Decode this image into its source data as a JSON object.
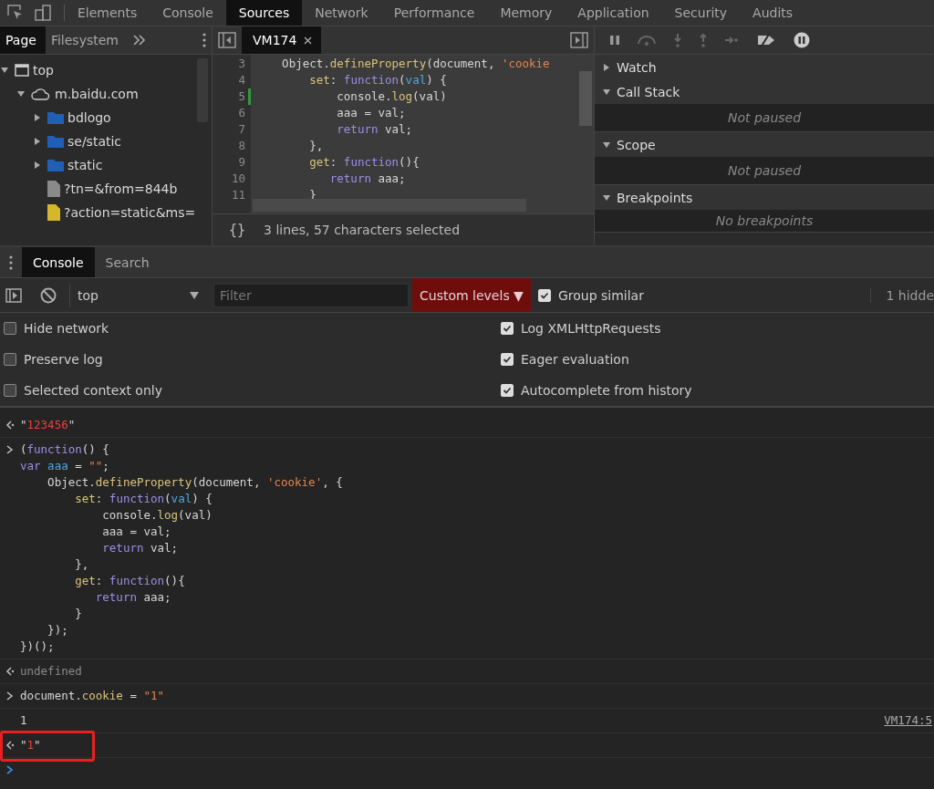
{
  "main_tabs": [
    {
      "label": "Elements",
      "selected": false
    },
    {
      "label": "Console",
      "selected": false
    },
    {
      "label": "Sources",
      "selected": true
    },
    {
      "label": "Network",
      "selected": false
    },
    {
      "label": "Performance",
      "selected": false
    },
    {
      "label": "Memory",
      "selected": false
    },
    {
      "label": "Application",
      "selected": false
    },
    {
      "label": "Security",
      "selected": false
    },
    {
      "label": "Audits",
      "selected": false
    }
  ],
  "navigator": {
    "tabs": [
      {
        "label": "Page",
        "selected": true
      },
      {
        "label": "Filesystem",
        "selected": false
      }
    ],
    "tree": [
      {
        "label": "top",
        "kind": "frame",
        "expanded": true,
        "children": [
          {
            "label": "m.baidu.com",
            "kind": "domain",
            "expanded": true,
            "children": [
              {
                "label": "bdlogo",
                "kind": "folder",
                "expanded": false
              },
              {
                "label": "se/static",
                "kind": "folder",
                "expanded": false
              },
              {
                "label": "static",
                "kind": "folder",
                "expanded": false
              },
              {
                "label": "?tn=&from=844b",
                "kind": "file",
                "color": "#8a8a8a"
              },
              {
                "label": "?action=static&ms=",
                "kind": "file",
                "color": "#d6b62a"
              }
            ]
          }
        ]
      }
    ]
  },
  "editor": {
    "tab": "VM174",
    "lines": [
      {
        "number": "3",
        "marked": false,
        "tokens": [
          {
            "kind": "plain",
            "text": "    Object."
          },
          {
            "kind": "fn",
            "text": "defineProperty"
          },
          {
            "kind": "plain",
            "text": "(document, "
          },
          {
            "kind": "str",
            "text": "'cookie"
          }
        ]
      },
      {
        "number": "4",
        "marked": false,
        "tokens": [
          {
            "kind": "fn",
            "text": "        set"
          },
          {
            "kind": "plain",
            "text": ": "
          },
          {
            "kind": "kw",
            "text": "function"
          },
          {
            "kind": "plain",
            "text": "("
          },
          {
            "kind": "var",
            "text": "val"
          },
          {
            "kind": "plain",
            "text": ") {"
          }
        ]
      },
      {
        "number": "5",
        "marked": true,
        "tokens": [
          {
            "kind": "plain",
            "text": "            console."
          },
          {
            "kind": "fn",
            "text": "log"
          },
          {
            "kind": "plain",
            "text": "(val)"
          }
        ]
      },
      {
        "number": "6",
        "marked": false,
        "tokens": [
          {
            "kind": "plain",
            "text": "            aaa = val;"
          }
        ]
      },
      {
        "number": "7",
        "marked": false,
        "tokens": [
          {
            "kind": "kw",
            "text": "            return"
          },
          {
            "kind": "plain",
            "text": " val;"
          }
        ]
      },
      {
        "number": "8",
        "marked": false,
        "tokens": [
          {
            "kind": "plain",
            "text": "        },"
          }
        ]
      },
      {
        "number": "9",
        "marked": false,
        "tokens": [
          {
            "kind": "fn",
            "text": "        get"
          },
          {
            "kind": "plain",
            "text": ": "
          },
          {
            "kind": "kw",
            "text": "function"
          },
          {
            "kind": "plain",
            "text": "(){"
          }
        ]
      },
      {
        "number": "10",
        "marked": false,
        "tokens": [
          {
            "kind": "kw",
            "text": "           return"
          },
          {
            "kind": "plain",
            "text": " aaa;"
          }
        ]
      },
      {
        "number": "11",
        "marked": false,
        "tokens": [
          {
            "kind": "plain",
            "text": "        }"
          }
        ]
      }
    ],
    "status_icon": "{}",
    "status": "3 lines, 57 characters selected"
  },
  "debugger": {
    "sections": [
      {
        "title": "Watch",
        "expanded": false
      },
      {
        "title": "Call Stack",
        "expanded": true,
        "body": "Not paused"
      },
      {
        "title": "Scope",
        "expanded": true,
        "body": "Not paused"
      },
      {
        "title": "Breakpoints",
        "expanded": true,
        "body": "No breakpoints"
      }
    ]
  },
  "drawer": {
    "tabs": [
      {
        "label": "Console",
        "selected": true
      },
      {
        "label": "Search",
        "selected": false
      }
    ]
  },
  "console_toolbar": {
    "context": "top",
    "filter_placeholder": "Filter",
    "levels": "Custom levels ▼",
    "group_similar": {
      "label": "Group similar",
      "checked": true
    },
    "hidden_count": "1 hidde"
  },
  "settings": [
    {
      "label": "Hide network",
      "checked": false
    },
    {
      "label": "Log XMLHttpRequests",
      "checked": true
    },
    {
      "label": "Preserve log",
      "checked": false
    },
    {
      "label": "Eager evaluation",
      "checked": true
    },
    {
      "label": "Selected context only",
      "checked": false
    },
    {
      "label": "Autocomplete from history",
      "checked": true
    }
  ],
  "messages": [
    {
      "kind": "result",
      "highlighted": false,
      "lines": [
        [
          {
            "kind": "plain",
            "text": "\""
          },
          {
            "kind": "red",
            "text": "123456"
          },
          {
            "kind": "plain",
            "text": "\""
          }
        ]
      ]
    },
    {
      "kind": "input",
      "highlighted": false,
      "lines": [
        [
          {
            "kind": "plain",
            "text": "("
          },
          {
            "kind": "kw",
            "text": "function"
          },
          {
            "kind": "plain",
            "text": "() {"
          }
        ],
        [
          {
            "kind": "kw",
            "text": "var "
          },
          {
            "kind": "var",
            "text": "aaa"
          },
          {
            "kind": "plain",
            "text": " = "
          },
          {
            "kind": "str",
            "text": "\"\""
          },
          {
            "kind": "plain",
            "text": ";"
          }
        ],
        [
          {
            "kind": "plain",
            "text": "    Object."
          },
          {
            "kind": "fn",
            "text": "defineProperty"
          },
          {
            "kind": "plain",
            "text": "(document, "
          },
          {
            "kind": "str",
            "text": "'cookie'"
          },
          {
            "kind": "plain",
            "text": ", {"
          }
        ],
        [
          {
            "kind": "fn",
            "text": "        set"
          },
          {
            "kind": "plain",
            "text": ": "
          },
          {
            "kind": "kw",
            "text": "function"
          },
          {
            "kind": "plain",
            "text": "("
          },
          {
            "kind": "var",
            "text": "val"
          },
          {
            "kind": "plain",
            "text": ") {"
          }
        ],
        [
          {
            "kind": "plain",
            "text": "            console."
          },
          {
            "kind": "fn",
            "text": "log"
          },
          {
            "kind": "plain",
            "text": "(val)"
          }
        ],
        [
          {
            "kind": "plain",
            "text": "            aaa = val;"
          }
        ],
        [
          {
            "kind": "kw",
            "text": "            return"
          },
          {
            "kind": "plain",
            "text": " val;"
          }
        ],
        [
          {
            "kind": "plain",
            "text": "        },"
          }
        ],
        [
          {
            "kind": "fn",
            "text": "        get"
          },
          {
            "kind": "plain",
            "text": ": "
          },
          {
            "kind": "kw",
            "text": "function"
          },
          {
            "kind": "plain",
            "text": "(){"
          }
        ],
        [
          {
            "kind": "kw",
            "text": "           return"
          },
          {
            "kind": "plain",
            "text": " aaa;"
          }
        ],
        [
          {
            "kind": "plain",
            "text": "        }"
          }
        ],
        [
          {
            "kind": "plain",
            "text": "    });"
          }
        ],
        [
          {
            "kind": "plain",
            "text": "})();"
          }
        ]
      ]
    },
    {
      "kind": "result",
      "highlighted": false,
      "lines": [
        [
          {
            "kind": "muted",
            "text": "undefined"
          }
        ]
      ]
    },
    {
      "kind": "input",
      "highlighted": false,
      "lines": [
        [
          {
            "kind": "plain",
            "text": "document."
          },
          {
            "kind": "fn",
            "text": "cookie"
          },
          {
            "kind": "plain",
            "text": " = "
          },
          {
            "kind": "str",
            "text": "\"1\""
          }
        ]
      ]
    },
    {
      "kind": "log",
      "highlighted": false,
      "source": "VM174:5",
      "lines": [
        [
          {
            "kind": "plain",
            "text": "1"
          }
        ]
      ]
    },
    {
      "kind": "result",
      "highlighted": true,
      "lines": [
        [
          {
            "kind": "plain",
            "text": "\""
          },
          {
            "kind": "red",
            "text": "1"
          },
          {
            "kind": "plain",
            "text": "\""
          }
        ]
      ]
    },
    {
      "kind": "prompt",
      "highlighted": false
    }
  ]
}
